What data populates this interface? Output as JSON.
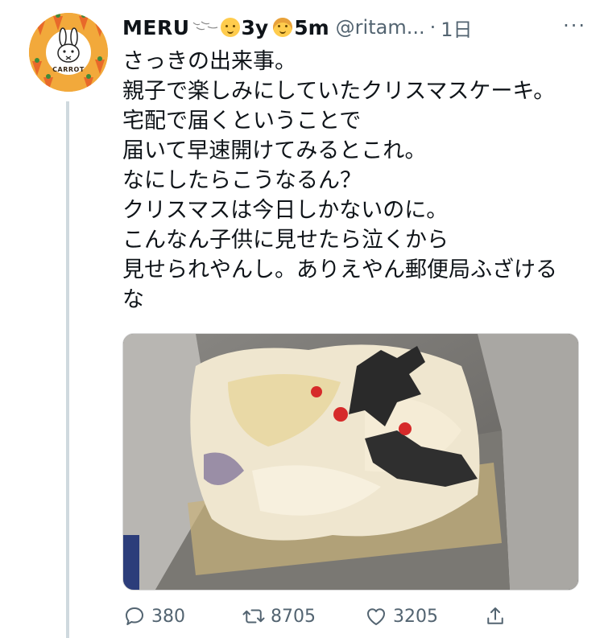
{
  "header": {
    "display_name": "MERU",
    "age_1": "3y",
    "age_2": "5m",
    "handle": "@ritam...",
    "separator": "·",
    "time": "1日",
    "more": "···"
  },
  "avatar": {
    "label": "CARROT"
  },
  "tweet": {
    "lines": [
      "さっきの出来事。",
      "親子で楽しみにしていたクリスマスケーキ。",
      "宅配で届くということで",
      "届いて早速開けてみるとこれ。",
      "なにしたらこうなるん？",
      "クリスマスは今日しかないのに。",
      "こんなん子供に見せたら泣くから",
      "見せられやんし。ありえやん郵便局ふざける",
      "な"
    ]
  },
  "actions": {
    "replies": "380",
    "retweets": "8705",
    "likes": "3205"
  },
  "colors": {
    "text": "#0f1419",
    "secondary": "#536471",
    "avatar_bg": "#f2a93b",
    "thread_line": "#cfd9de"
  },
  "icons": [
    "reply-icon",
    "retweet-icon",
    "like-icon",
    "share-icon",
    "more-icon"
  ]
}
